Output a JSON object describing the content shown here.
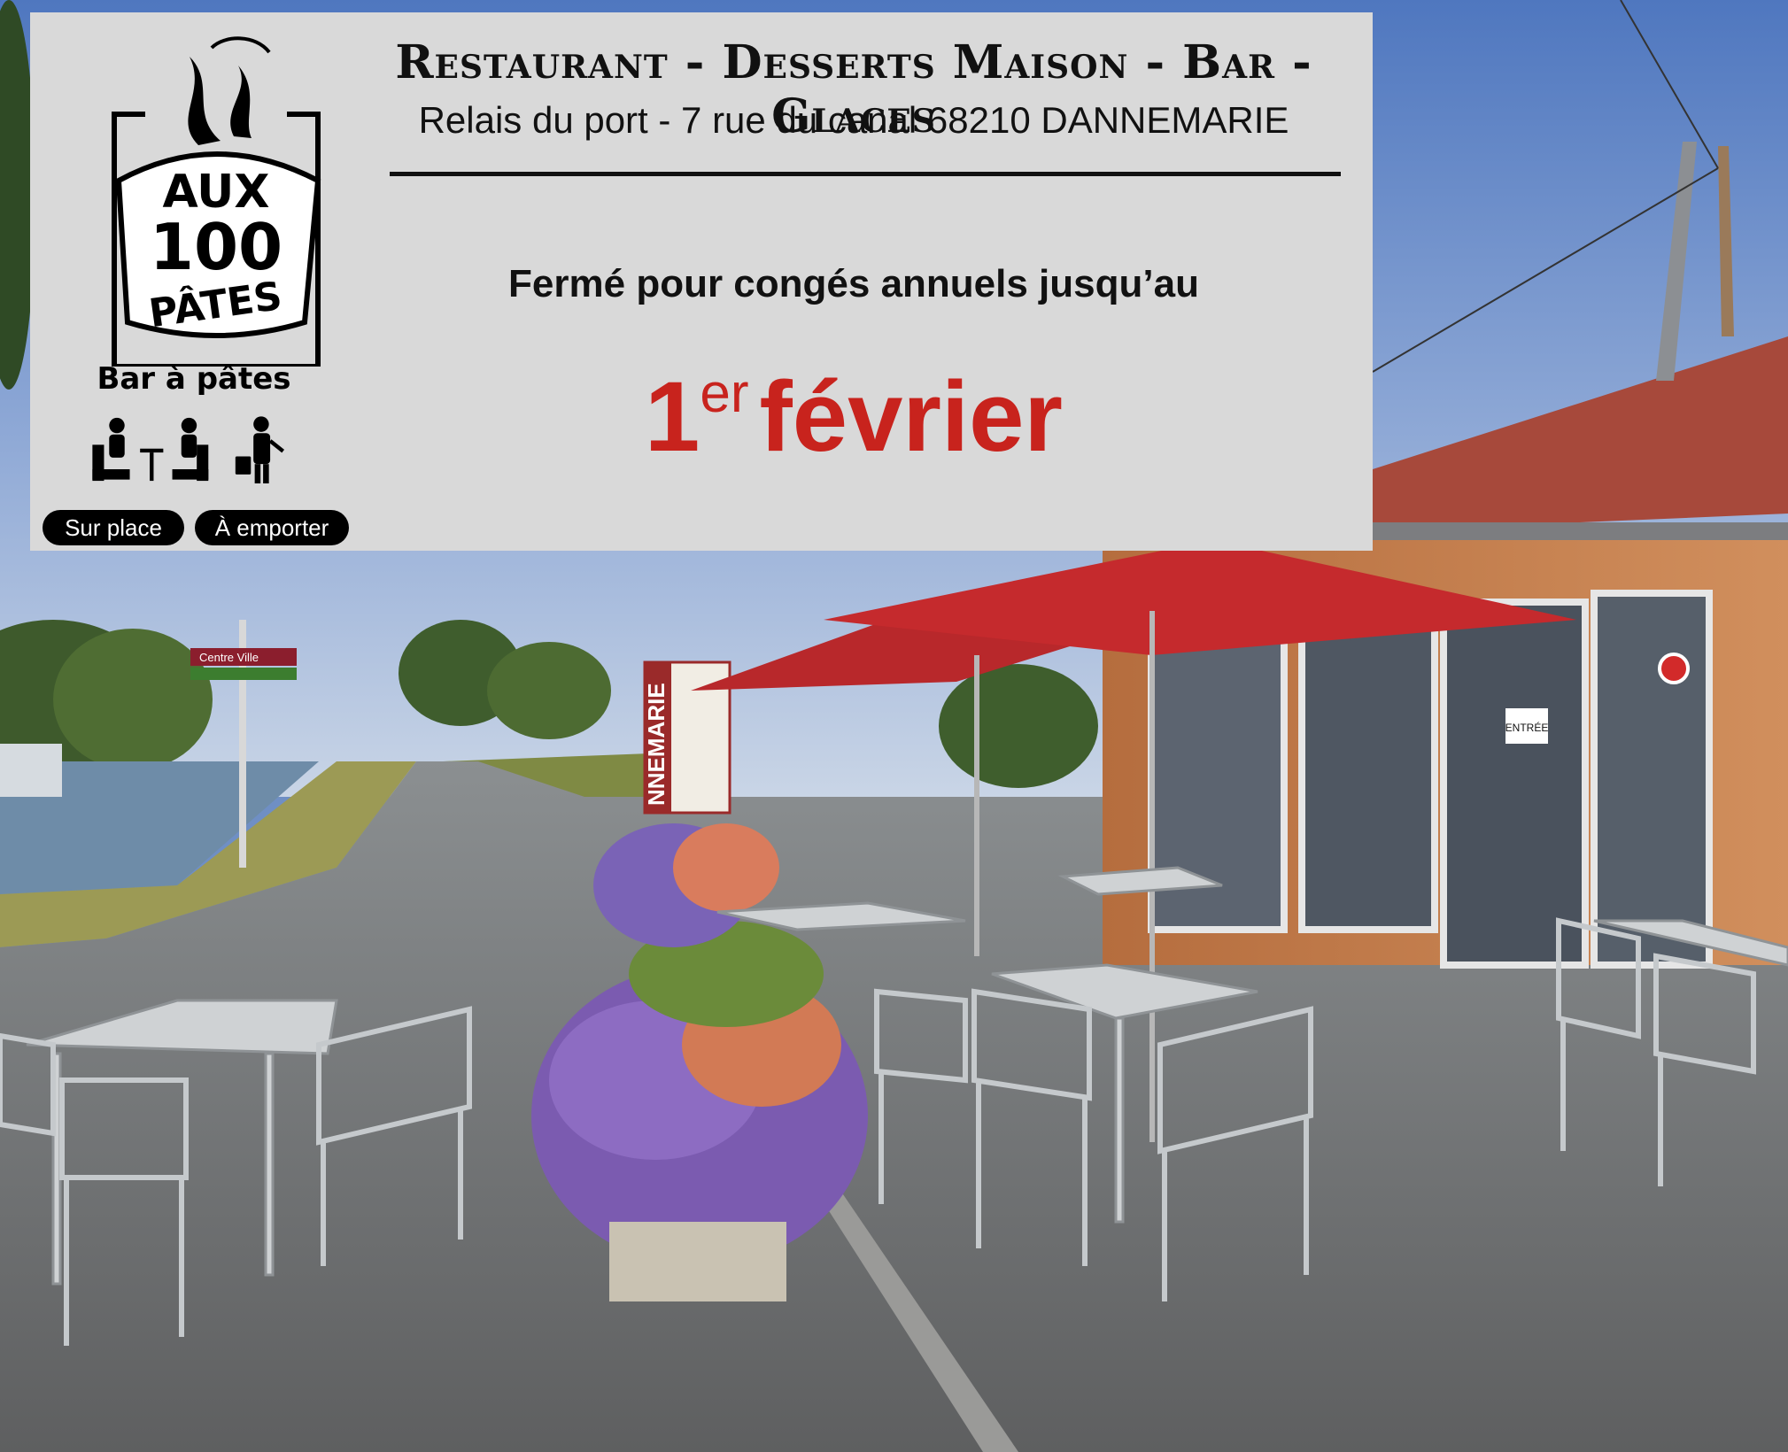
{
  "header": {
    "title": "Restaurant - Desserts Maison - Bar - Glaces",
    "address": "Relais du port - 7 rue du canal 68210 DANNEMARIE"
  },
  "logo": {
    "line1": "AUX",
    "line2": "100",
    "line3": "PÂTES",
    "tagline": "Bar à pâtes"
  },
  "services": {
    "dine_in": "Sur place",
    "takeaway": "À emporter"
  },
  "notice": {
    "text": "Fermé pour congés annuels jusqu’au",
    "date_number": "1",
    "date_suffix": "er",
    "date_month": "février"
  },
  "signs": {
    "town": "NNEMARIE",
    "direction": "Centre Ville",
    "entry": "ENTRÉE"
  },
  "colors": {
    "accent": "#c8231d",
    "panel": "#d9d9d9",
    "umbrella": "#c52a2d",
    "building_wood": "#c07a4a",
    "roof": "#a7493b"
  }
}
